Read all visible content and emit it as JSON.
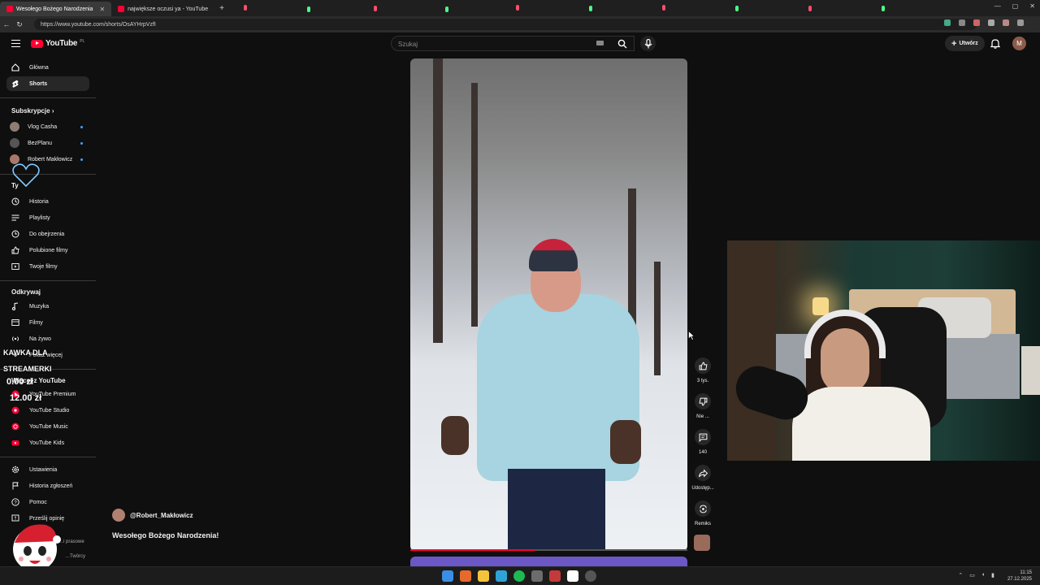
{
  "browser": {
    "tabs": [
      {
        "label": "Wesołego Bożego Narodzenia",
        "active": true
      },
      {
        "label": "największe oczusi ya - YouTube",
        "active": false
      }
    ],
    "url": "https://www.youtube.com/shorts/OsAYHrpVzfI"
  },
  "header": {
    "logo_text": "YouTube",
    "logo_region": "PL",
    "search_placeholder": "Szukaj",
    "create_label": "Utwórz",
    "avatar_letter": "M"
  },
  "sidebar": {
    "main": [
      {
        "label": "Główna",
        "icon": "home-icon"
      },
      {
        "label": "Shorts",
        "icon": "shorts-icon",
        "active": true
      }
    ],
    "subscriptions_title": "Subskrypcje",
    "subscriptions": [
      {
        "label": "Vlog Casha"
      },
      {
        "label": "BezPlanu"
      },
      {
        "label": "Robert Makłowicz"
      }
    ],
    "you_title": "Ty",
    "you": [
      {
        "label": "Historia",
        "icon": "history-icon"
      },
      {
        "label": "Playlisty",
        "icon": "playlist-icon"
      },
      {
        "label": "Do obejrzenia",
        "icon": "clock-icon"
      },
      {
        "label": "Polubione filmy",
        "icon": "like-icon"
      },
      {
        "label": "Twoje filmy",
        "icon": "video-icon"
      }
    ],
    "explore_title": "Odkrywaj",
    "explore": [
      {
        "label": "Muzyka",
        "icon": "music-icon"
      },
      {
        "label": "Filmy",
        "icon": "film-icon"
      },
      {
        "label": "Na żywo",
        "icon": "live-icon"
      },
      {
        "label": "Pokaż więcej",
        "icon": "chevron-down-icon"
      }
    ],
    "more_title": "Więcej z YouTube",
    "more": [
      {
        "label": "YouTube Premium"
      },
      {
        "label": "YouTube Studio"
      },
      {
        "label": "YouTube Music"
      },
      {
        "label": "YouTube Kids"
      }
    ],
    "settings": [
      {
        "label": "Ustawienia",
        "icon": "gear-icon"
      },
      {
        "label": "Historia zgłoszeń",
        "icon": "flag-icon"
      },
      {
        "label": "Pomoc",
        "icon": "help-icon"
      },
      {
        "label": "Prześlij opinię",
        "icon": "feedback-icon"
      }
    ],
    "footer_1": "…i prasowe",
    "footer_2": "…Twórcy"
  },
  "overlay": {
    "kawka_line1": "KAWKA DLA",
    "kawka_line2": "STREAMERKI",
    "amount_current": "0.00 zł",
    "amount_goal": "12.00 zł"
  },
  "video": {
    "channel": "@Robert_Makłowicz",
    "title": "Wesołego Bożego Narodzenia!",
    "progress": 0.45
  },
  "actions": {
    "likes": "3 tys.",
    "dislike": "Nie ...",
    "comments": "140",
    "share": "Udostęp...",
    "remix": "Remiks"
  },
  "taskbar": {
    "time": "11:15",
    "date": "27.12.2025"
  },
  "colors": {
    "yt_red": "#ff0033",
    "background": "#0f0f0f",
    "link_dot": "#3ea6ff"
  }
}
